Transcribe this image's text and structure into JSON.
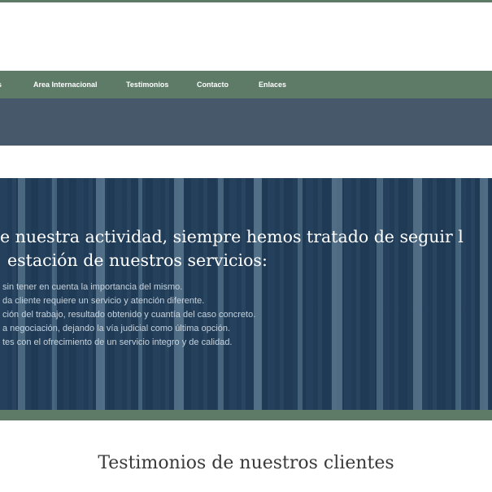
{
  "nav": {
    "items": [
      {
        "label": "s"
      },
      {
        "label": "Area Internacional"
      },
      {
        "label": "Testimonios"
      },
      {
        "label": "Contacto"
      },
      {
        "label": "Enlaces"
      }
    ]
  },
  "hero": {
    "heading_lines": [
      "e nuestra actividad, siempre hemos tratado de seguir l",
      "estación de nuestros servicios:"
    ],
    "list_lines": [
      "sin tener en cuenta la importancia del mismo.",
      "da cliente requiere un servicio y atención diferente.",
      "ción del trabajo, resultado obtenido y cuantía del caso concreto.",
      "a negociación, dejando la vía judicial como última opción.",
      "tes con el ofrecimiento de un servicio integro y de calidad."
    ]
  },
  "testimonials": {
    "title": "Testimonios de nuestros clientes"
  },
  "colors": {
    "nav_bg": "#5e7b68",
    "title_band": "#46586a",
    "hero_overlay": "#1f3a56",
    "text_light": "#ffffff"
  }
}
